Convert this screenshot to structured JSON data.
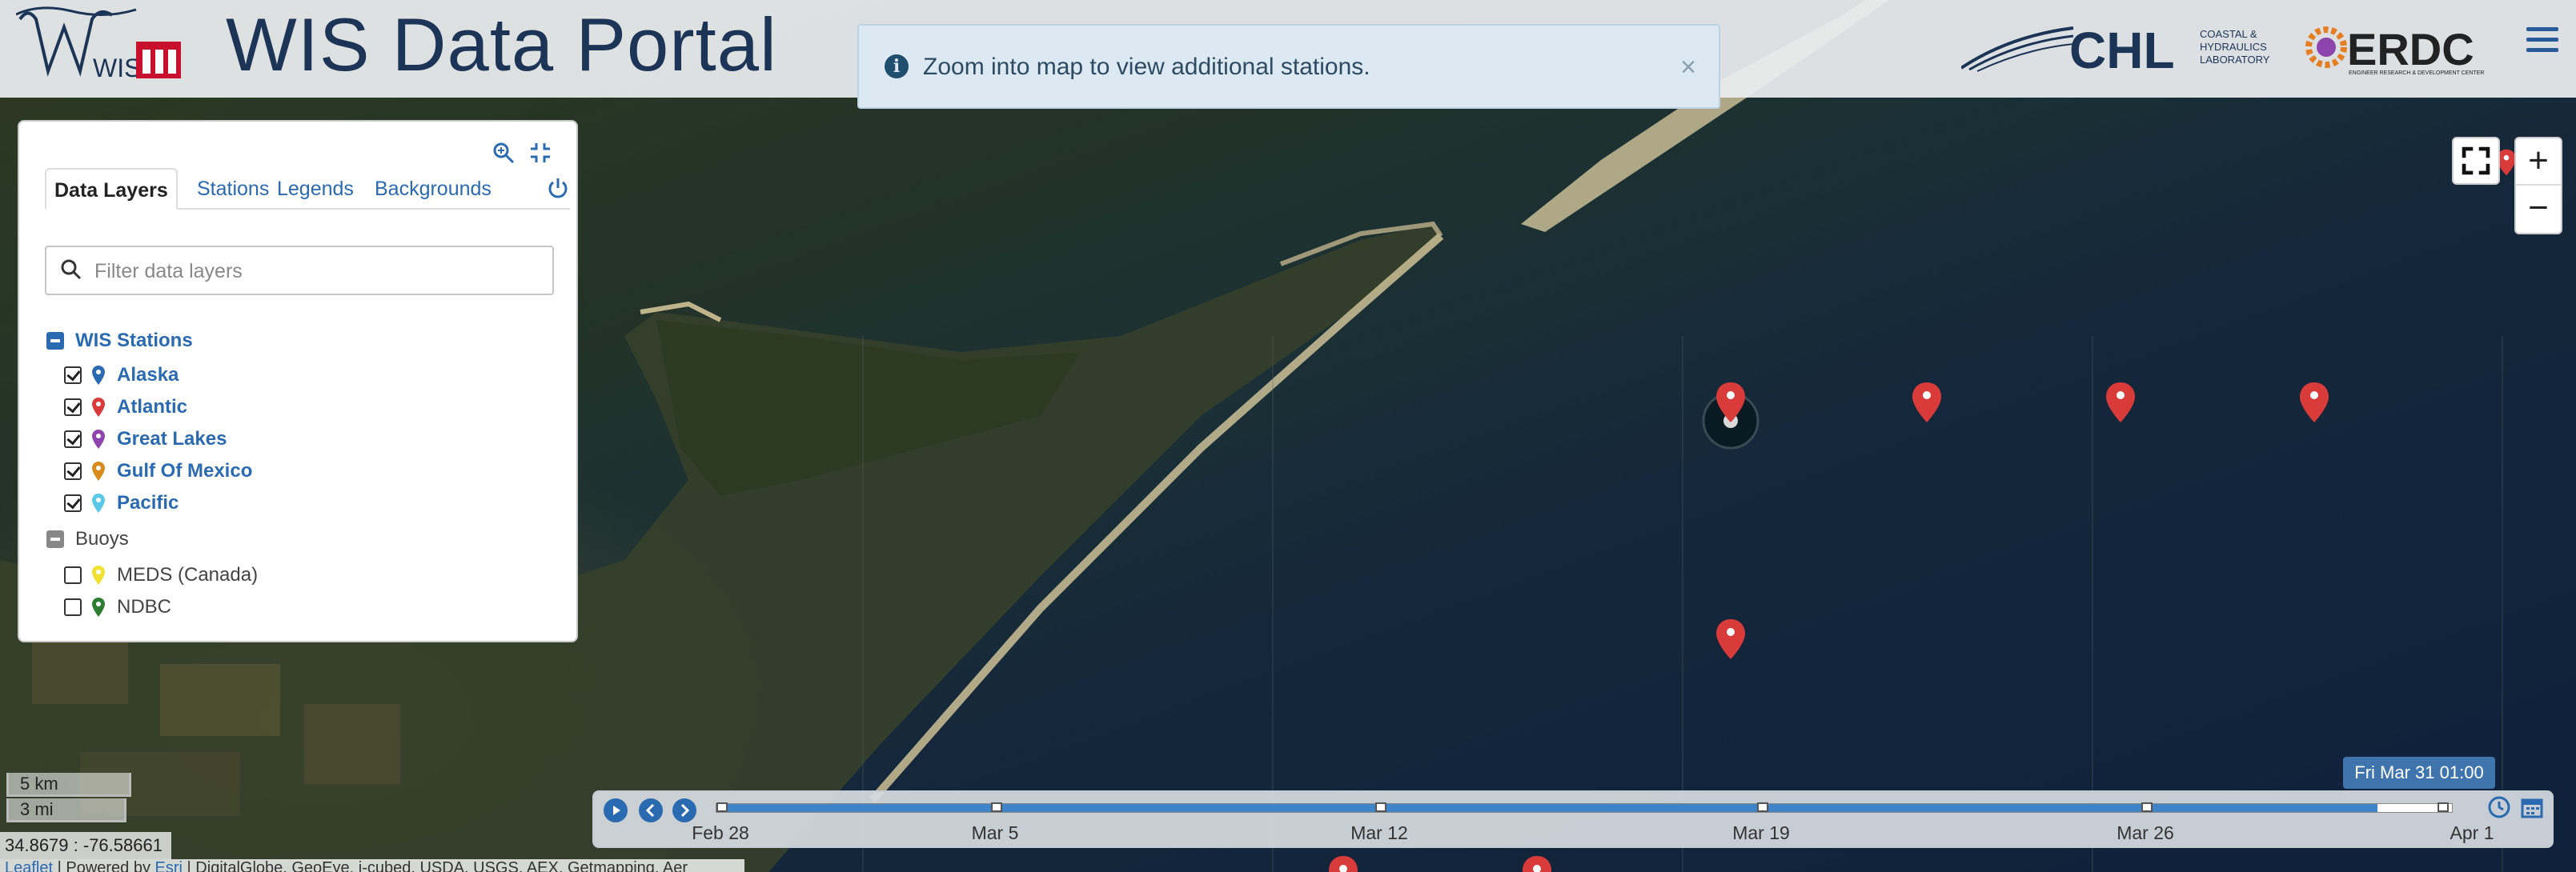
{
  "header": {
    "logo_text": "WIS",
    "title": "WIS Data Portal",
    "chl_logo_text": "CHL",
    "chl_subtitle": [
      "COASTAL &",
      "HYDRAULICS",
      "LABORATORY"
    ],
    "erdc_logo_text": "ERDC",
    "erdc_subtitle": "ENGINEER RESEARCH & DEVELOPMENT CENTER"
  },
  "notification": {
    "message": "Zoom into map to view additional stations.",
    "close_label": "×"
  },
  "panel": {
    "tabs": [
      {
        "label": "Data Layers",
        "active": true
      },
      {
        "label": "Stations",
        "active": false
      },
      {
        "label": "Legends",
        "active": false
      },
      {
        "label": "Backgrounds",
        "active": false
      }
    ],
    "search_placeholder": "Filter data layers",
    "groups": [
      {
        "label": "WIS Stations",
        "layers": [
          {
            "label": "Alaska",
            "checked": true,
            "color": "#2a6ab0"
          },
          {
            "label": "Atlantic",
            "checked": true,
            "color": "#d93a3a"
          },
          {
            "label": "Great Lakes",
            "checked": true,
            "color": "#8e44ad"
          },
          {
            "label": "Gulf Of Mexico",
            "checked": true,
            "color": "#d68b1c"
          },
          {
            "label": "Pacific",
            "checked": true,
            "color": "#5bc8e8"
          }
        ]
      },
      {
        "label": "Buoys",
        "layers": [
          {
            "label": "MEDS (Canada)",
            "checked": false,
            "color": "#f0e130"
          },
          {
            "label": "NDBC",
            "checked": false,
            "color": "#2e7d32"
          }
        ]
      }
    ]
  },
  "map": {
    "zoom_in": "+",
    "zoom_out": "−",
    "scale_km": "5 km",
    "scale_mi": "3 mi",
    "coordinates": "34.8679 : -76.58661",
    "attribution": {
      "leaflet": "Leaflet",
      "powered_by": " | Powered by ",
      "esri": "Esri",
      "sources": " | DigitalGlobe, GeoEye, i-cubed, USDA, USGS, AEX, Getmapping, Aer"
    },
    "marker_color": "#d93a3a"
  },
  "timeline": {
    "current_time": "Fri Mar 31 01:00",
    "progress": 0.957,
    "labels": [
      "Feb 28",
      "Mar 5",
      "Mar 12",
      "Mar 19",
      "Mar 26",
      "Apr 1"
    ]
  }
}
